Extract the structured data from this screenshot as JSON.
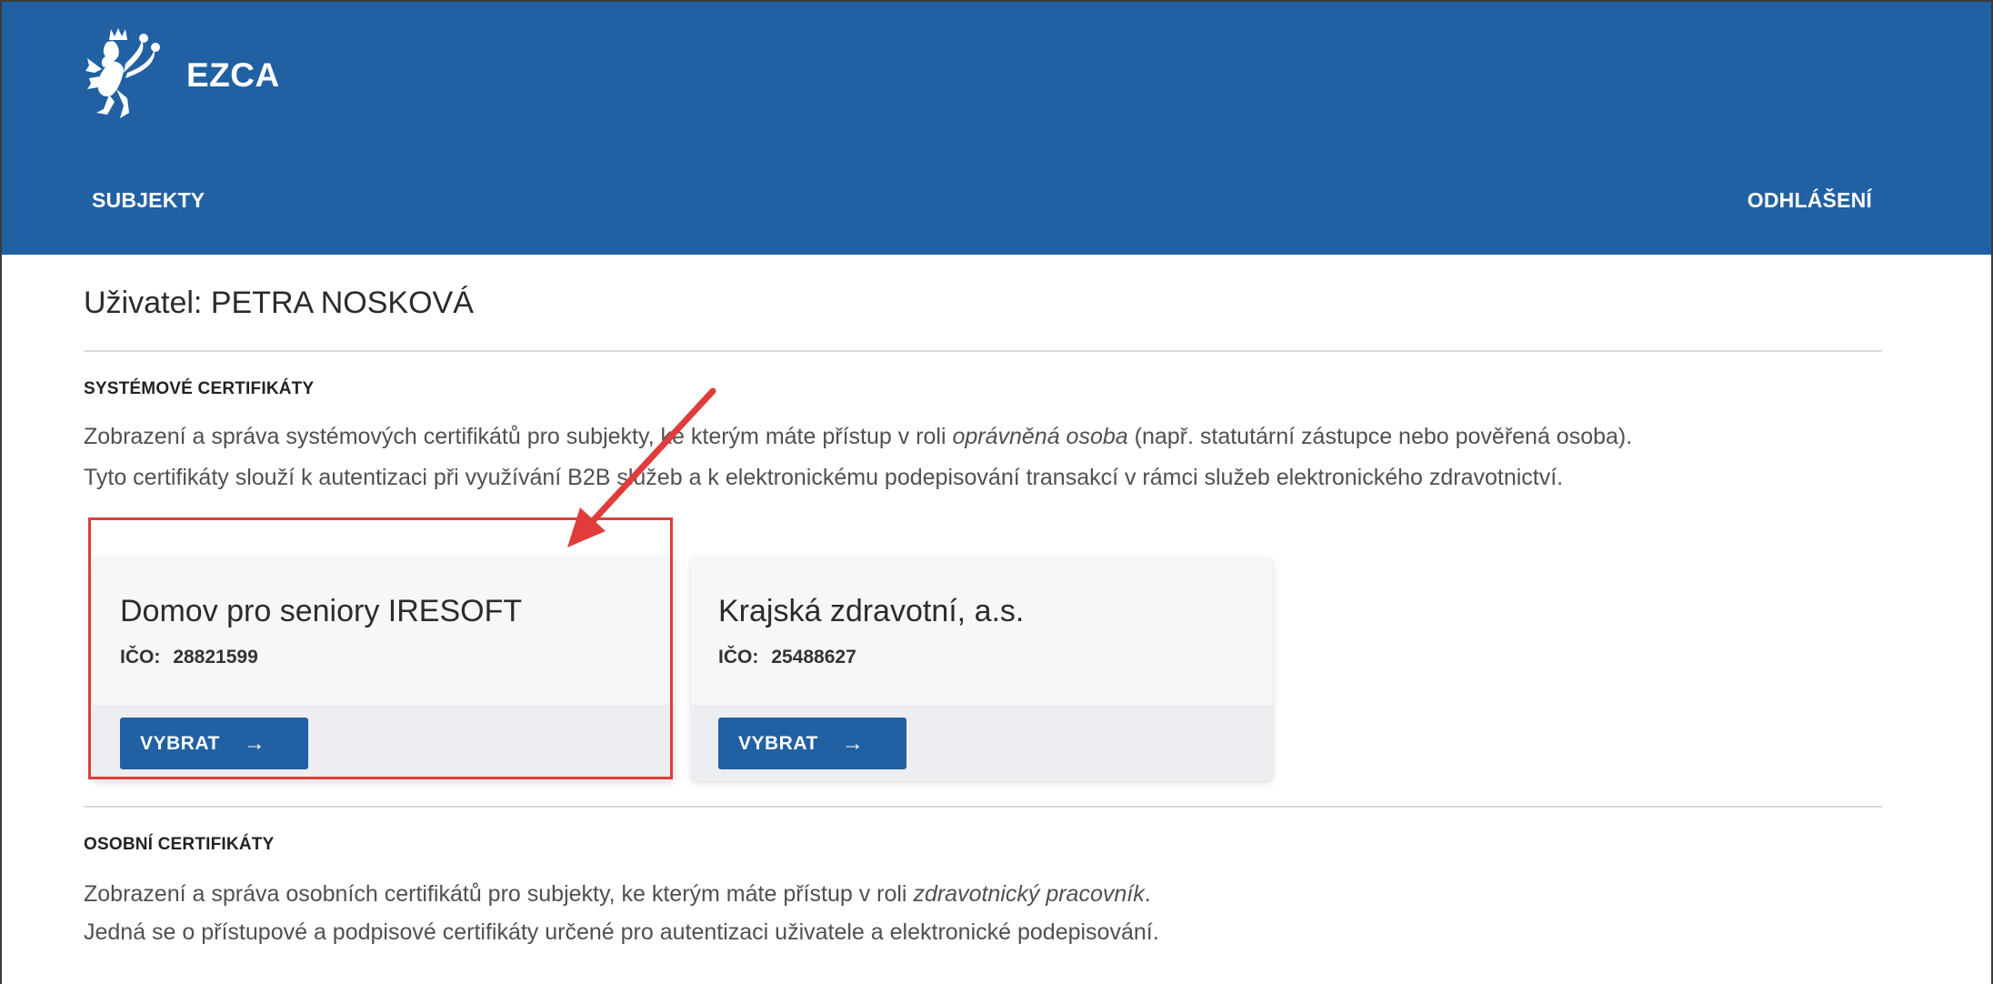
{
  "header": {
    "brand": "EZCA",
    "nav_left": "SUBJEKTY",
    "nav_right": "ODHLÁŠENÍ"
  },
  "user": {
    "title": "Uživatel: PETRA NOSKOVÁ"
  },
  "system_certificates": {
    "heading": "SYSTÉMOVÉ CERTIFIKÁTY",
    "line1_pre": "Zobrazení a správa systémových certifikátů pro subjekty, ke kterým máte přístup v roli ",
    "line1_em": "oprávněná osoba",
    "line1_post": " (např. statutární zástupce nebo pověřená osoba).",
    "line2": "Tyto certifikáty slouží k autentizaci při využívání B2B služeb a k elektronickému podepisování transakcí v rámci služeb elektronického zdravotnictví.",
    "cards": [
      {
        "name": "Domov pro seniory IRESOFT",
        "ico_label": "IČO:",
        "ico": "28821599",
        "button": "VYBRAT"
      },
      {
        "name": "Krajská zdravotní, a.s.",
        "ico_label": "IČO:",
        "ico": "25488627",
        "button": "VYBRAT"
      }
    ]
  },
  "personal_certificates": {
    "heading": "OSOBNÍ CERTIFIKÁTY",
    "line1_pre": "Zobrazení a správa osobních certifikátů pro subjekty, ke kterým máte přístup v roli ",
    "line1_em": "zdravotnický pracovník",
    "line1_post": ".",
    "line2": "Jedná se o přístupové a podpisové certifikáty určené pro autentizaci uživatele a elektronické podepisování."
  },
  "colors": {
    "header_bg": "#2160a3",
    "button_bg": "#2160a3",
    "annotation": "#e03c3c"
  },
  "icons": {
    "logo": "czech-lion-emblem-icon",
    "button_arrow": "arrow-right-icon"
  }
}
